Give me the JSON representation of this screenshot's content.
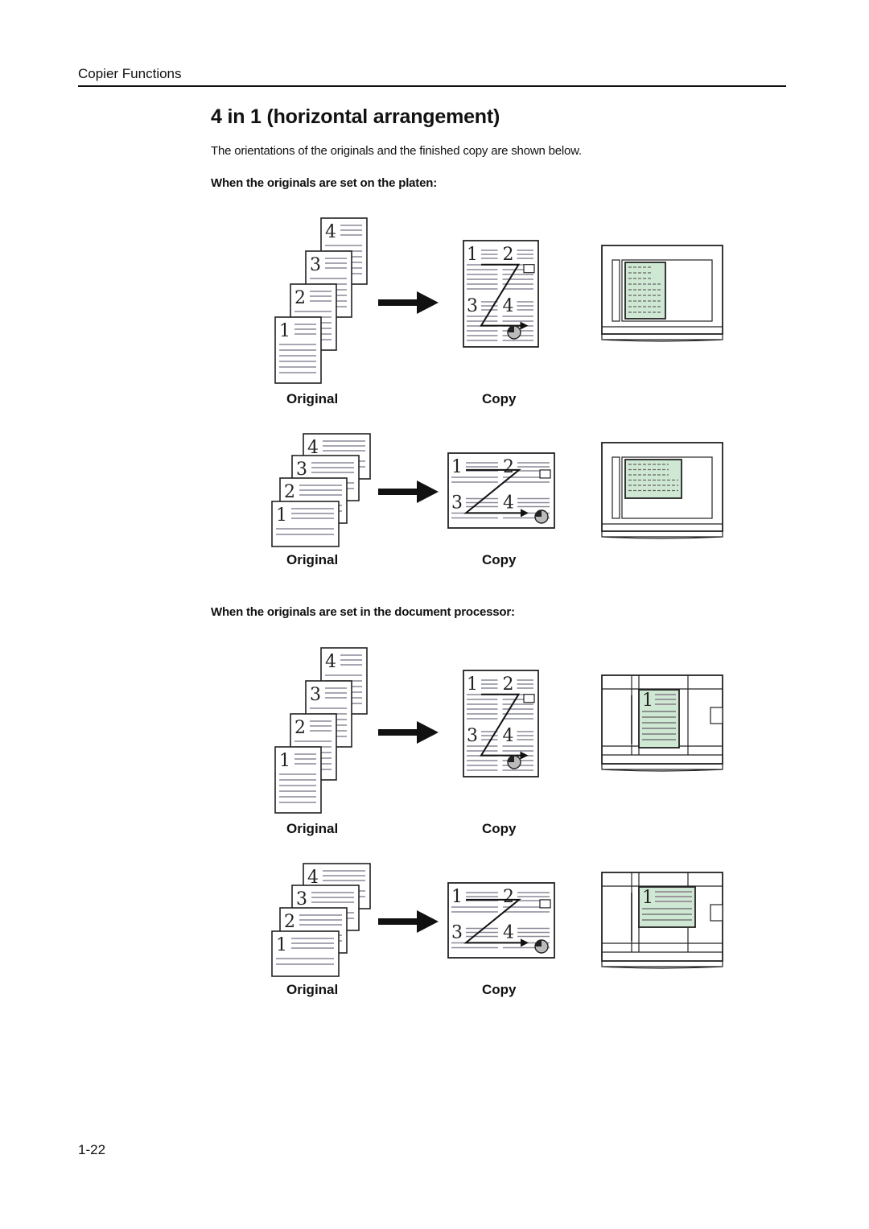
{
  "header": {
    "section": "Copier Functions"
  },
  "title": "4 in 1 (horizontal arrangement)",
  "intro": "The orientations of the originals and the finished copy are shown below.",
  "sections": [
    {
      "heading": "When the originals are set on the platen:",
      "figures": [
        {
          "orientation": "portrait",
          "original_label": "Original",
          "copy_label": "Copy",
          "device": "platen",
          "page_numbers": [
            "1",
            "2",
            "3",
            "4"
          ]
        },
        {
          "orientation": "landscape",
          "original_label": "Original",
          "copy_label": "Copy",
          "device": "platen",
          "page_numbers": [
            "1",
            "2",
            "3",
            "4"
          ]
        }
      ]
    },
    {
      "heading": "When the originals are set in the document processor:",
      "figures": [
        {
          "orientation": "portrait",
          "original_label": "Original",
          "copy_label": "Copy",
          "device": "document-processor",
          "page_numbers": [
            "1",
            "2",
            "3",
            "4"
          ]
        },
        {
          "orientation": "landscape",
          "original_label": "Original",
          "copy_label": "Copy",
          "device": "document-processor",
          "page_numbers": [
            "1",
            "2",
            "3",
            "4"
          ]
        }
      ]
    }
  ],
  "colors": {
    "paper_highlight": "#cfe8d3",
    "text_lines": "#8a8a9a",
    "ink": "#222222"
  },
  "page_number": "1-22"
}
